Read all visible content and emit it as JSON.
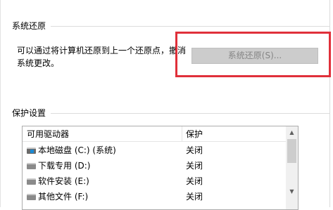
{
  "restore_group": {
    "title": "系统还原",
    "description_line1": "可以通过将计算机还原到上一个还原点，撤消",
    "description_line2": "系统更改。",
    "button_label": "系统还原(S)...",
    "highlight_color": "#e0303a"
  },
  "protection_group": {
    "title": "保护设置",
    "columns": [
      "可用驱动器",
      "保护"
    ],
    "drives": [
      {
        "name": "本地磁盘 (C:) (系统)",
        "status": "关闭",
        "icon": "system-drive-icon"
      },
      {
        "name": "下载专用 (D:)",
        "status": "关闭",
        "icon": "drive-icon"
      },
      {
        "name": "软件安装 (E:)",
        "status": "关闭",
        "icon": "drive-icon"
      },
      {
        "name": "其他文件 (F:)",
        "status": "关闭",
        "icon": "drive-icon"
      }
    ]
  }
}
